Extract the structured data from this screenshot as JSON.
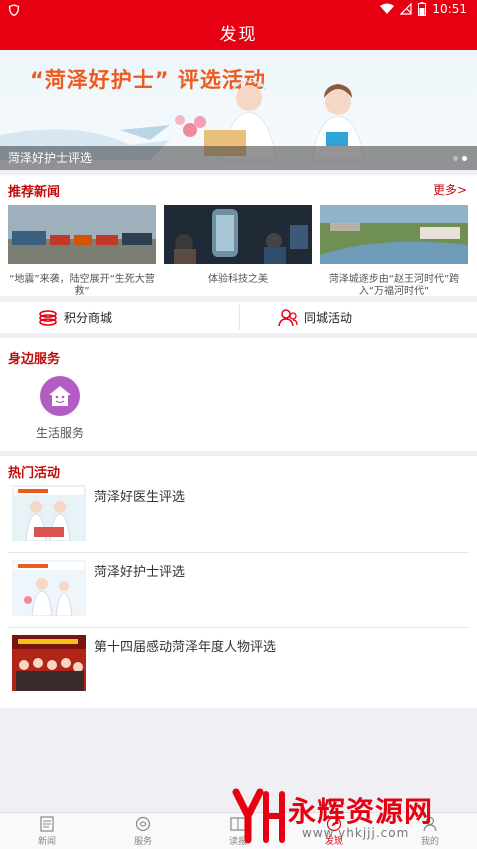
{
  "status": {
    "time": "10:51"
  },
  "title": "发现",
  "banner": {
    "headline": "“菏泽好护士” 评选活动",
    "caption": "菏泽好护士评选"
  },
  "news": {
    "title": "推荐新闻",
    "more": "更多>",
    "items": [
      {
        "caption": "“地震”来袭，陆空展开“生死大营救”"
      },
      {
        "caption": "体验科技之美"
      },
      {
        "caption": "菏泽城逐步由“赵王河时代”跨入“万福河时代”"
      }
    ]
  },
  "quick": {
    "points_mall": "积分商城",
    "city_events": "同城活动"
  },
  "service": {
    "title": "身边服务",
    "items": [
      {
        "label": "生活服务"
      }
    ]
  },
  "hot": {
    "title": "热门活动",
    "items": [
      {
        "title": "菏泽好医生评选"
      },
      {
        "title": "菏泽好护士评选"
      },
      {
        "title": "第十四届感动菏泽年度人物评选"
      }
    ]
  },
  "tabs": [
    {
      "label": "新闻",
      "icon": "news-icon"
    },
    {
      "label": "服务",
      "icon": "service-icon"
    },
    {
      "label": "读报",
      "icon": "newspaper-icon"
    },
    {
      "label": "发现",
      "icon": "discover-icon",
      "active": true
    },
    {
      "label": "我的",
      "icon": "profile-icon"
    }
  ],
  "watermark": {
    "text": "永辉资源网",
    "url": "www.yhkjjj.com"
  },
  "colors": {
    "brand": "#e60012",
    "section": "#c20c0c",
    "service_icon": "#b35cc6"
  }
}
